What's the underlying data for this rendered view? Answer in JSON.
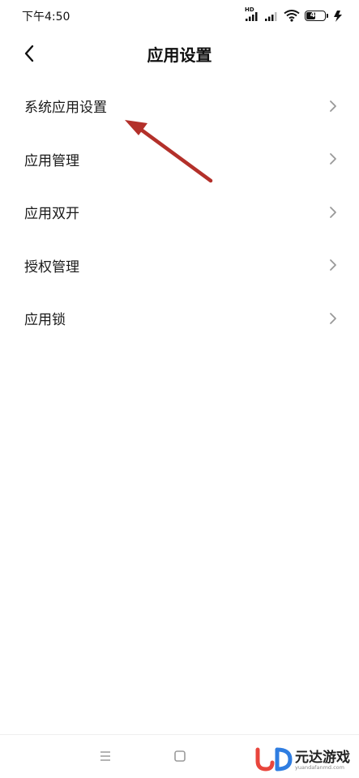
{
  "status_bar": {
    "time": "下午4:50",
    "sim1_label": "HD",
    "battery_level": "45",
    "battery_fraction": 0.45
  },
  "header": {
    "title": "应用设置"
  },
  "settings": {
    "items": [
      {
        "label": "系统应用设置"
      },
      {
        "label": "应用管理"
      },
      {
        "label": "应用双开"
      },
      {
        "label": "授权管理"
      },
      {
        "label": "应用锁"
      }
    ]
  },
  "annotation": {
    "color": "#b3302a"
  },
  "watermark": {
    "text": "元达游戏",
    "url": "yuandafanmd.com",
    "colors": {
      "red": "#e8453c",
      "blue": "#2f7de1"
    }
  }
}
